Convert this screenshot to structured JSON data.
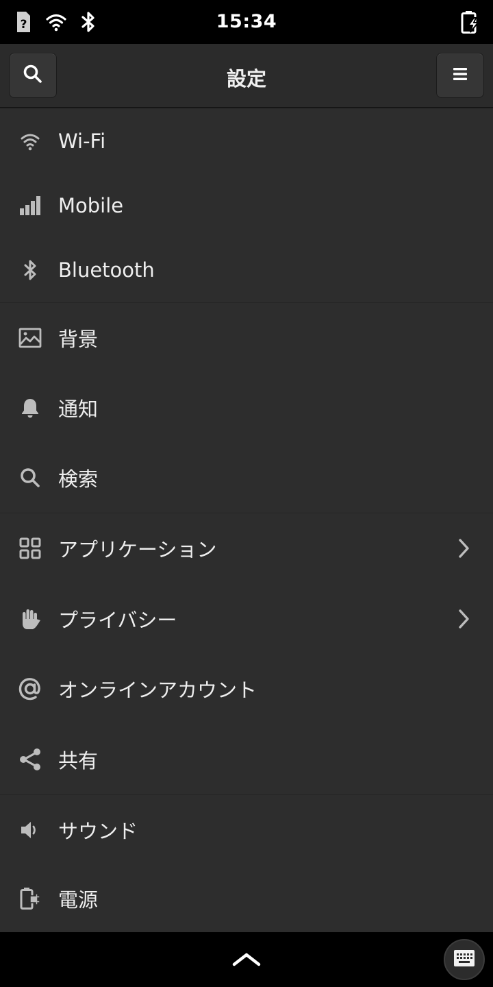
{
  "status_bar": {
    "time": "15:34",
    "icons": [
      "sim-unknown-icon",
      "wifi-icon",
      "bluetooth-icon",
      "battery-charging-icon"
    ]
  },
  "header": {
    "title": "設定",
    "search_icon": "search-icon",
    "menu_icon": "hamburger-menu-icon"
  },
  "settings": {
    "items": [
      {
        "label": "Wi-Fi",
        "icon": "wifi-icon"
      },
      {
        "label": "Mobile",
        "icon": "signal-bars-icon"
      },
      {
        "label": "Bluetooth",
        "icon": "bluetooth-icon"
      },
      {
        "label": "背景",
        "icon": "image-icon"
      },
      {
        "label": "通知",
        "icon": "bell-icon"
      },
      {
        "label": "検索",
        "icon": "search-icon"
      },
      {
        "label": "アプリケーション",
        "icon": "apps-grid-icon",
        "has_submenu": true
      },
      {
        "label": "プライバシー",
        "icon": "hand-icon",
        "has_submenu": true
      },
      {
        "label": "オンラインアカウント",
        "icon": "at-sign-icon"
      },
      {
        "label": "共有",
        "icon": "share-icon"
      },
      {
        "label": "サウンド",
        "icon": "speaker-icon"
      },
      {
        "label": "電源",
        "icon": "battery-plug-icon"
      }
    ]
  },
  "bottom_bar": {
    "handle_icon": "chevron-up-icon",
    "keyboard_icon": "keyboard-icon"
  },
  "colors": {
    "list_background": "#2d2d2d",
    "header_background": "#2b2b2b",
    "text": "#eeeeee",
    "icon": "#bdbdbd"
  }
}
